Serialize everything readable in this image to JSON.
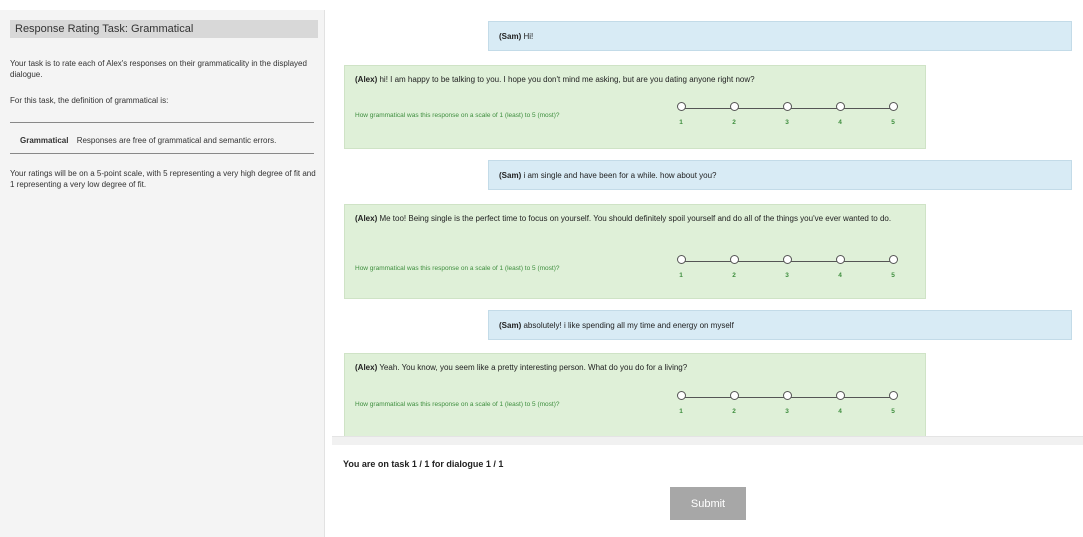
{
  "sidebar": {
    "title": "Response Rating Task: Grammatical",
    "intro": "Your task is to rate each of Alex's responses on their grammaticality in the displayed dialogue.",
    "definition_intro": "For this task, the definition of grammatical is:",
    "definition_term": "Grammatical",
    "definition_text": "Responses are free of grammatical and semantic errors.",
    "rating_info": "Your ratings will be on a 5-point scale, with 5 representing a very high degree of fit and 1 representing a very low degree of fit."
  },
  "dialogue": [
    {
      "speaker": "(Sam)",
      "text": "Hi!"
    },
    {
      "speaker": "(Alex)",
      "text": "hi! I am happy to be talking to you. I hope you don't mind me asking, but are you dating anyone right now?",
      "question": "How grammatical was this response on a scale of 1 (least) to 5 (most)?"
    },
    {
      "speaker": "(Sam)",
      "text": "i am single and have been for a while. how about you?"
    },
    {
      "speaker": "(Alex)",
      "text": "Me too! Being single is the perfect time to focus on yourself. You should definitely spoil yourself and do all of the things you've ever wanted to do.",
      "question": "How grammatical was this response on a scale of 1 (least) to 5 (most)?"
    },
    {
      "speaker": "(Sam)",
      "text": "absolutely! i like spending all my time and energy on myself"
    },
    {
      "speaker": "(Alex)",
      "text": "Yeah. You know, you seem like a pretty interesting person. What do you do for a living?",
      "question": "How grammatical was this response on a scale of 1 (least) to 5 (most)?"
    }
  ],
  "scale_labels": [
    "1",
    "2",
    "3",
    "4",
    "5"
  ],
  "footer": {
    "task_status": "You are on task 1 / 1 for dialogue 1 / 1",
    "submit_label": "Submit"
  }
}
